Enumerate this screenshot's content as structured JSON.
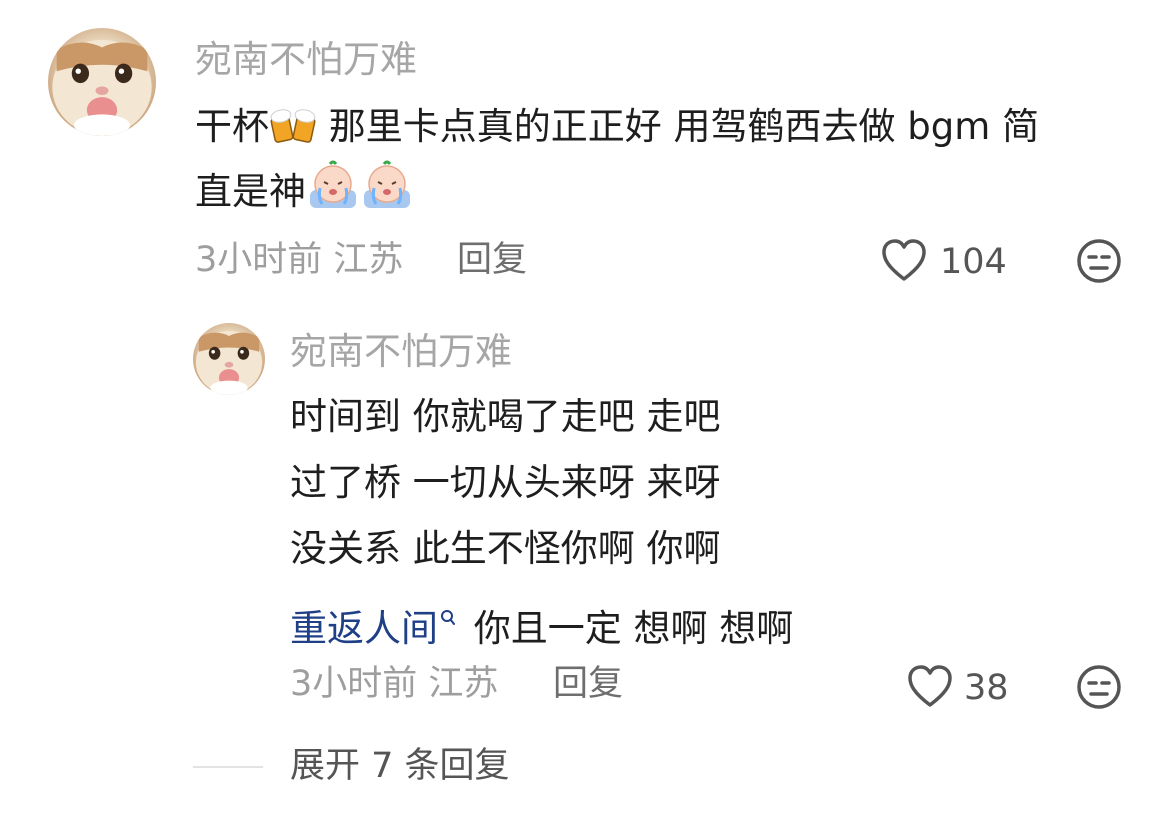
{
  "comment": {
    "username": "宛南不怕万难",
    "line1_before": "干杯",
    "line1_after": "那里卡点真的正正好 用驾鹤西去做 bgm 简",
    "line2": "直是神",
    "emoji_beer": "beer-mugs-emoji",
    "emoji_crying": "crying-baby-emoji",
    "time": "3小时前",
    "location": "江苏",
    "reply_label": "回复",
    "likes": "104"
  },
  "reply": {
    "username": "宛南不怕万难",
    "lines": [
      "时间到 你就喝了走吧 走吧",
      "过了桥 一切从头来呀 来呀",
      "没关系 此生不怪你啊 你啊"
    ],
    "link_text": "重返人间",
    "last_line_after": "你且一定 想啊 想啊",
    "time": "3小时前",
    "location": "江苏",
    "reply_label": "回复",
    "likes": "38"
  },
  "expand_label": "展开 7 条回复"
}
